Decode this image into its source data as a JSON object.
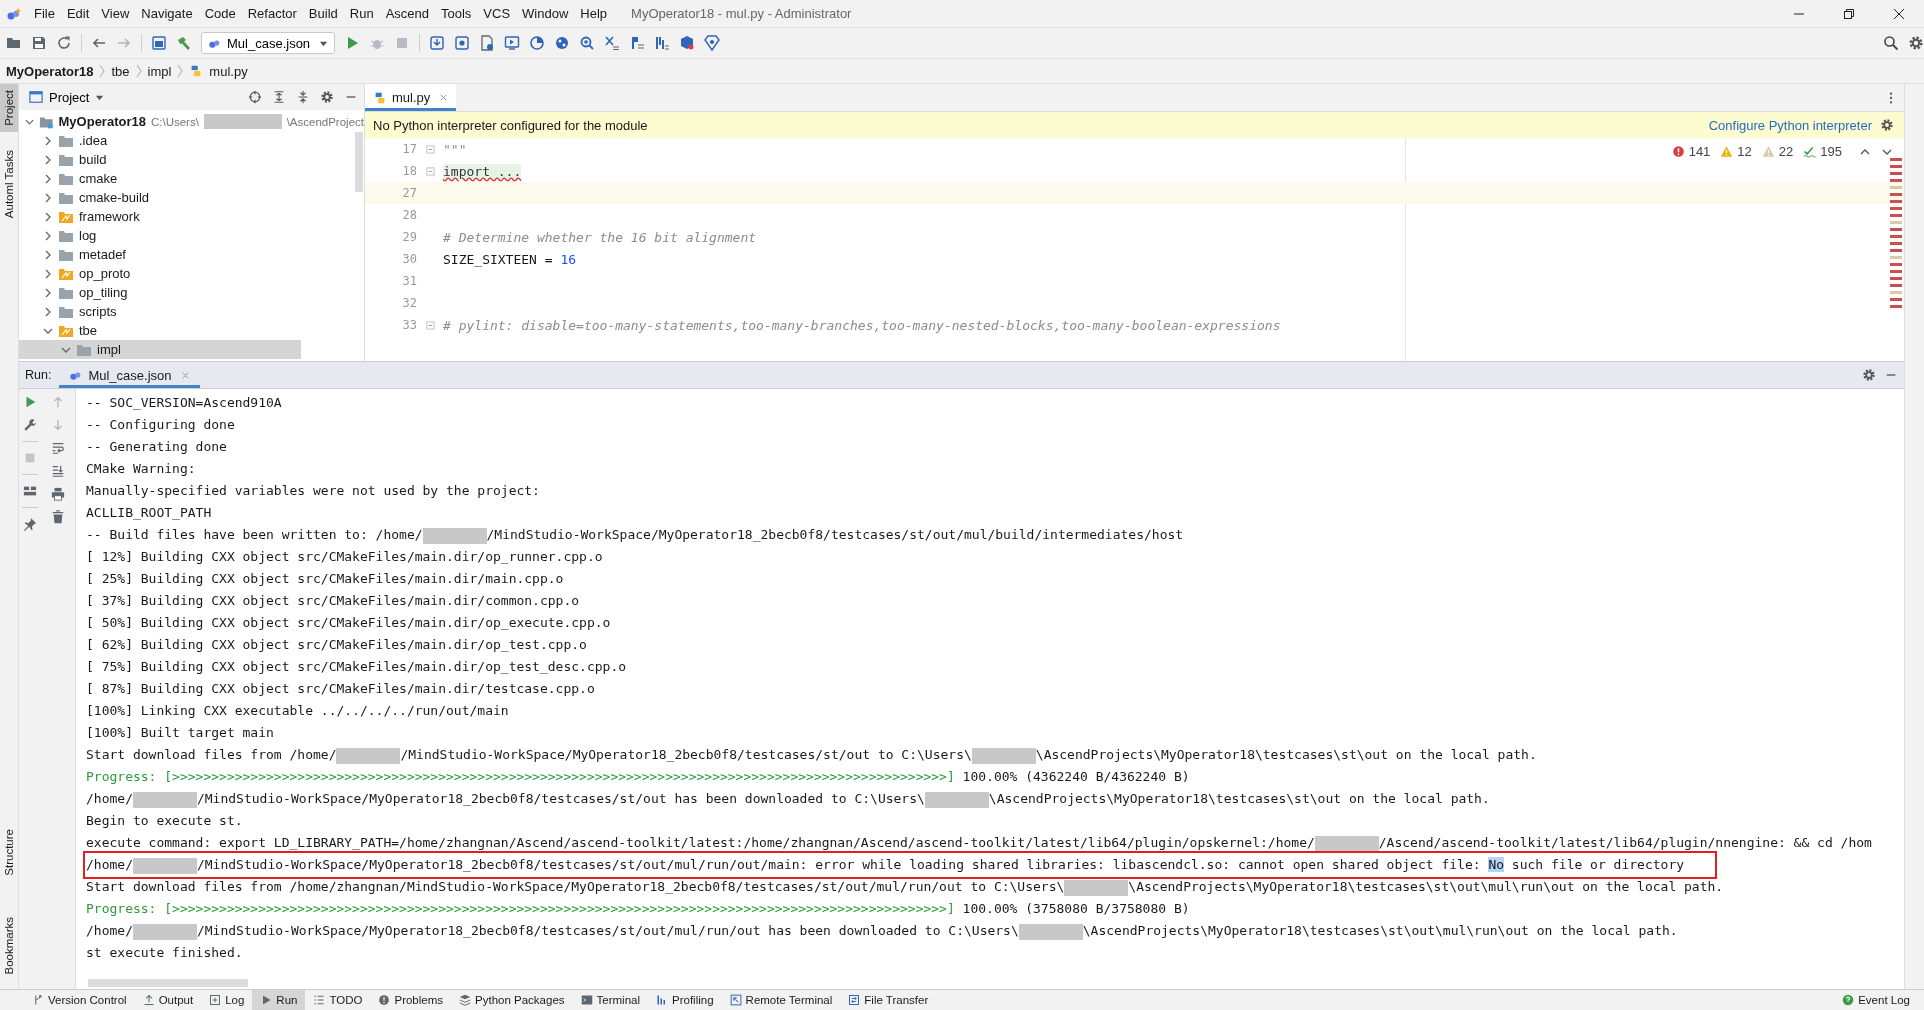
{
  "window": {
    "title": "MyOperator18 - mul.py - Administrator"
  },
  "menu": [
    "File",
    "Edit",
    "View",
    "Navigate",
    "Code",
    "Refactor",
    "Build",
    "Run",
    "Ascend",
    "Tools",
    "VCS",
    "Window",
    "Help"
  ],
  "toolbar": {
    "run_config": "Mul_case.json"
  },
  "breadcrumb": [
    "MyOperator18",
    "tbe",
    "impl",
    "mul.py"
  ],
  "left_strip": {
    "top": [
      {
        "label": "Project",
        "selected": true
      },
      {
        "label": "Automl Tasks",
        "selected": false
      }
    ],
    "bottom": [
      {
        "label": "Structure"
      },
      {
        "label": "Bookmarks"
      }
    ]
  },
  "project": {
    "title": "Project",
    "tree": [
      {
        "name": "MyOperator18",
        "kind": "project",
        "path": [
          {
            "kind": "text",
            "text": "C:\\Users\\"
          },
          {
            "kind": "redacted"
          },
          {
            "kind": "text",
            "text": "\\AscendProject"
          }
        ],
        "expanded": true,
        "children": [
          {
            "name": ".idea",
            "kind": "folder",
            "expanded": false
          },
          {
            "name": "build",
            "kind": "folder",
            "expanded": false
          },
          {
            "name": "cmake",
            "kind": "folder",
            "expanded": false
          },
          {
            "name": "cmake-build",
            "kind": "folder",
            "expanded": false
          },
          {
            "name": "framework",
            "kind": "module",
            "expanded": false
          },
          {
            "name": "log",
            "kind": "folder",
            "expanded": false
          },
          {
            "name": "metadef",
            "kind": "folder",
            "expanded": false
          },
          {
            "name": "op_proto",
            "kind": "module",
            "expanded": false
          },
          {
            "name": "op_tiling",
            "kind": "folder",
            "expanded": false
          },
          {
            "name": "scripts",
            "kind": "folder",
            "expanded": false
          },
          {
            "name": "tbe",
            "kind": "module",
            "expanded": true,
            "children": [
              {
                "name": "impl",
                "kind": "folder",
                "expanded": true
              }
            ]
          }
        ]
      }
    ]
  },
  "editor": {
    "tabs": [
      {
        "label": "mul.py",
        "selected": true
      }
    ],
    "banner": {
      "message": "No Python interpreter configured for the module",
      "action": "Configure Python interpreter"
    },
    "inspections": {
      "errors": "141",
      "warnings": "12",
      "weak_warnings": "22",
      "typos": "195"
    },
    "lines": [
      {
        "number": "17",
        "current": false,
        "fold_marker": true,
        "tokens": [
          {
            "kind": "docstring",
            "text": "\"\"\""
          }
        ]
      },
      {
        "number": "18",
        "current": false,
        "fold_marker": true,
        "tokens": [
          {
            "kind": "folded",
            "text": "import ..."
          }
        ]
      },
      {
        "number": "27",
        "current": true,
        "fold_marker": false
      },
      {
        "number": "28",
        "current": false,
        "fold_marker": false
      },
      {
        "number": "29",
        "current": false,
        "fold_marker": false,
        "tokens": [
          {
            "kind": "comment",
            "text": "# Determine whether the 16 bit alignment"
          }
        ]
      },
      {
        "number": "30",
        "current": false,
        "fold_marker": false,
        "tokens": [
          {
            "kind": "plain",
            "text": "SIZE_SIXTEEN = "
          },
          {
            "kind": "number",
            "text": "16"
          }
        ]
      },
      {
        "number": "31",
        "current": false,
        "fold_marker": false
      },
      {
        "number": "32",
        "current": false,
        "fold_marker": false
      },
      {
        "number": "33",
        "current": false,
        "fold_marker": true,
        "tokens": [
          {
            "kind": "comment",
            "text": "# pylint: disable=too-many-statements,too-many-branches,too-many-nested-blocks,too-many-boolean-expressions"
          }
        ]
      }
    ]
  },
  "run": {
    "label": "Run:",
    "tabs": [
      {
        "label": "Mul_case.json",
        "selected": true
      }
    ],
    "console": [
      {
        "boxed": false,
        "segments": [
          {
            "kind": "text",
            "text": "-- SOC_VERSION=Ascend910A"
          }
        ]
      },
      {
        "boxed": false,
        "segments": [
          {
            "kind": "text",
            "text": "-- Configuring done"
          }
        ]
      },
      {
        "boxed": false,
        "segments": [
          {
            "kind": "text",
            "text": "-- Generating done"
          }
        ]
      },
      {
        "boxed": false,
        "segments": [
          {
            "kind": "text",
            "text": "CMake Warning:"
          }
        ]
      },
      {
        "boxed": false,
        "segments": [
          {
            "kind": "text",
            "text": "Manually-specified variables were not used by the project:"
          }
        ]
      },
      {
        "boxed": false,
        "segments": [
          {
            "kind": "text",
            "text": "ACLLIB_ROOT_PATH"
          }
        ]
      },
      {
        "boxed": false,
        "segments": [
          {
            "kind": "text",
            "text": "-- Build files have been written to: /home/"
          },
          {
            "kind": "redacted"
          },
          {
            "kind": "text",
            "text": "/MindStudio-WorkSpace/MyOperator18_2becb0f8/testcases/st/out/mul/build/intermediates/host"
          }
        ]
      },
      {
        "boxed": false,
        "segments": [
          {
            "kind": "text",
            "text": "[ 12%] Building CXX object src/CMakeFiles/main.dir/op_runner.cpp.o"
          }
        ]
      },
      {
        "boxed": false,
        "segments": [
          {
            "kind": "text",
            "text": "[ 25%] Building CXX object src/CMakeFiles/main.dir/main.cpp.o"
          }
        ]
      },
      {
        "boxed": false,
        "segments": [
          {
            "kind": "text",
            "text": "[ 37%] Building CXX object src/CMakeFiles/main.dir/common.cpp.o"
          }
        ]
      },
      {
        "boxed": false,
        "segments": [
          {
            "kind": "text",
            "text": "[ 50%] Building CXX object src/CMakeFiles/main.dir/op_execute.cpp.o"
          }
        ]
      },
      {
        "boxed": false,
        "segments": [
          {
            "kind": "text",
            "text": "[ 62%] Building CXX object src/CMakeFiles/main.dir/op_test.cpp.o"
          }
        ]
      },
      {
        "boxed": false,
        "segments": [
          {
            "kind": "text",
            "text": "[ 75%] Building CXX object src/CMakeFiles/main.dir/op_test_desc.cpp.o"
          }
        ]
      },
      {
        "boxed": false,
        "segments": [
          {
            "kind": "text",
            "text": "[ 87%] Building CXX object src/CMakeFiles/main.dir/testcase.cpp.o"
          }
        ]
      },
      {
        "boxed": false,
        "segments": [
          {
            "kind": "text",
            "text": "[100%] Linking CXX executable ../../../../run/out/main"
          }
        ]
      },
      {
        "boxed": false,
        "segments": [
          {
            "kind": "text",
            "text": "[100%] Built target main"
          }
        ]
      },
      {
        "boxed": false,
        "segments": [
          {
            "kind": "text",
            "text": "Start download files from /home/"
          },
          {
            "kind": "redacted"
          },
          {
            "kind": "text",
            "text": "/MindStudio-WorkSpace/MyOperator18_2becb0f8/testcases/st/out to C:\\Users\\"
          },
          {
            "kind": "redacted"
          },
          {
            "kind": "text",
            "text": "\\AscendProjects\\MyOperator18\\testcases\\st\\out on the local path."
          }
        ]
      },
      {
        "boxed": false,
        "segments": [
          {
            "kind": "progress",
            "text": "Progress: [>>>>>>>>>>>>>>>>>>>>>>>>>>>>>>>>>>>>>>>>>>>>>>>>>>>>>>>>>>>>>>>>>>>>>>>>>>>>>>>>>>>>>>>>>>>>>>>>>>>]"
          },
          {
            "kind": "text",
            "text": " 100.00% (4362240 B/4362240 B)"
          }
        ]
      },
      {
        "boxed": false,
        "segments": [
          {
            "kind": "text",
            "text": "/home/"
          },
          {
            "kind": "redacted"
          },
          {
            "kind": "text",
            "text": "/MindStudio-WorkSpace/MyOperator18_2becb0f8/testcases/st/out has been downloaded to C:\\Users\\"
          },
          {
            "kind": "redacted"
          },
          {
            "kind": "text",
            "text": "\\AscendProjects\\MyOperator18\\testcases\\st\\out on the local path."
          }
        ]
      },
      {
        "boxed": false,
        "segments": [
          {
            "kind": "text",
            "text": "Begin to execute st."
          }
        ]
      },
      {
        "boxed": false,
        "segments": [
          {
            "kind": "text",
            "text": "execute command: export LD_LIBRARY_PATH=/home/zhangnan/Ascend/ascend-toolkit/latest:/home/zhangnan/Ascend/ascend-toolkit/latest/lib64/plugin/opskernel:/home/"
          },
          {
            "kind": "redacted"
          },
          {
            "kind": "text",
            "text": "/Ascend/ascend-toolkit/latest/lib64/plugin/nnengine: && cd /hom"
          }
        ]
      },
      {
        "boxed": true,
        "segments": [
          {
            "kind": "text",
            "text": "/home/"
          },
          {
            "kind": "redacted"
          },
          {
            "kind": "text",
            "text": "/MindStudio-WorkSpace/MyOperator18_2becb0f8/testcases/st/out/mul/run/out/main: error while loading shared libraries: libascendcl.so: cannot open shared object file: "
          },
          {
            "kind": "match",
            "text": "No"
          },
          {
            "kind": "text",
            "text": " such file or directory"
          }
        ]
      },
      {
        "boxed": false,
        "segments": [
          {
            "kind": "text",
            "text": "Start download files from /home/zhangnan/MindStudio-WorkSpace/MyOperator18_2becb0f8/testcases/st/out/mul/run/out to C:\\Users\\"
          },
          {
            "kind": "redacted"
          },
          {
            "kind": "text",
            "text": "\\AscendProjects\\MyOperator18\\testcases\\st\\out\\mul\\run\\out on the local path."
          }
        ]
      },
      {
        "boxed": false,
        "segments": [
          {
            "kind": "progress",
            "text": "Progress: [>>>>>>>>>>>>>>>>>>>>>>>>>>>>>>>>>>>>>>>>>>>>>>>>>>>>>>>>>>>>>>>>>>>>>>>>>>>>>>>>>>>>>>>>>>>>>>>>>>>]"
          },
          {
            "kind": "text",
            "text": " 100.00% (3758080 B/3758080 B)"
          }
        ]
      },
      {
        "boxed": false,
        "segments": [
          {
            "kind": "text",
            "text": "/home/"
          },
          {
            "kind": "redacted"
          },
          {
            "kind": "text",
            "text": "/MindStudio-WorkSpace/MyOperator18_2becb0f8/testcases/st/out/mul/run/out has been downloaded to C:\\Users\\"
          },
          {
            "kind": "redacted"
          },
          {
            "kind": "text",
            "text": "\\AscendProjects\\MyOperator18\\testcases\\st\\out\\mul\\run\\out on the local path."
          }
        ]
      },
      {
        "boxed": false,
        "segments": [
          {
            "kind": "text",
            "text": "st execute finished."
          }
        ]
      }
    ]
  },
  "bottom_tabs": [
    {
      "label": "Version Control",
      "selected": false
    },
    {
      "label": "Output",
      "selected": false
    },
    {
      "label": "Log",
      "selected": false
    },
    {
      "label": "Run",
      "selected": true
    },
    {
      "label": "TODO",
      "selected": false
    },
    {
      "label": "Problems",
      "selected": false
    },
    {
      "label": "Python Packages",
      "selected": false
    },
    {
      "label": "Terminal",
      "selected": false
    },
    {
      "label": "Profiling",
      "selected": false
    },
    {
      "label": "Remote Terminal",
      "selected": false
    },
    {
      "label": "File Transfer",
      "selected": false
    }
  ],
  "event_log": "Event Log"
}
